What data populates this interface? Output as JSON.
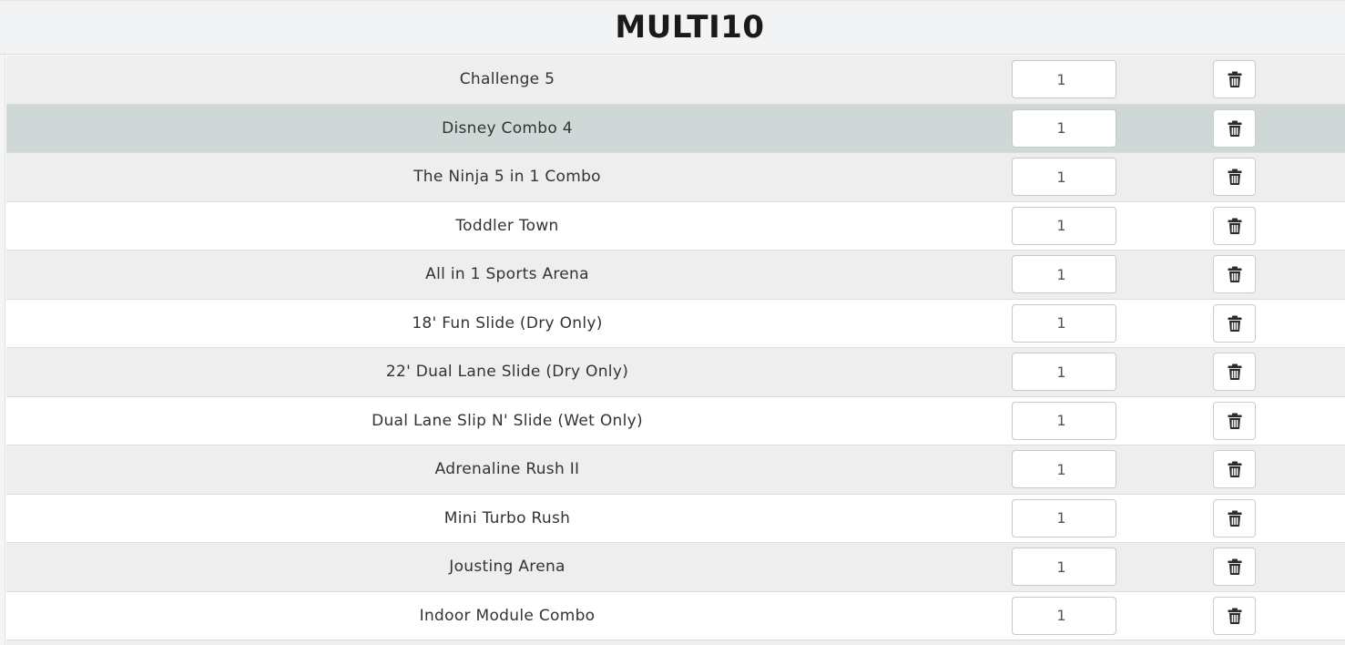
{
  "header": {
    "title": "MULTI10"
  },
  "colors": {
    "header_bg": "#f2f3f5",
    "row_shade": "#eeeeee",
    "row_highlight": "#cfd8d7",
    "row_plain": "#ffffff"
  },
  "items": [
    {
      "name": "Challenge 5",
      "qty": "1",
      "style": "shade",
      "delete_icon": "trash-icon"
    },
    {
      "name": "Disney Combo 4",
      "qty": "1",
      "style": "highlight",
      "delete_icon": "trash-icon"
    },
    {
      "name": "The Ninja 5 in 1 Combo",
      "qty": "1",
      "style": "shade",
      "delete_icon": "trash-icon"
    },
    {
      "name": "Toddler Town",
      "qty": "1",
      "style": "plain",
      "delete_icon": "trash-icon"
    },
    {
      "name": "All in 1 Sports Arena",
      "qty": "1",
      "style": "shade",
      "delete_icon": "trash-icon"
    },
    {
      "name": "18' Fun Slide (Dry Only)",
      "qty": "1",
      "style": "plain",
      "delete_icon": "trash-icon"
    },
    {
      "name": "22' Dual Lane Slide (Dry Only)",
      "qty": "1",
      "style": "shade",
      "delete_icon": "trash-icon"
    },
    {
      "name": "Dual Lane Slip N' Slide (Wet Only)",
      "qty": "1",
      "style": "plain",
      "delete_icon": "trash-icon"
    },
    {
      "name": "Adrenaline Rush II",
      "qty": "1",
      "style": "shade",
      "delete_icon": "trash-icon"
    },
    {
      "name": "Mini Turbo Rush",
      "qty": "1",
      "style": "plain",
      "delete_icon": "trash-icon"
    },
    {
      "name": "Jousting Arena",
      "qty": "1",
      "style": "shade",
      "delete_icon": "trash-icon"
    },
    {
      "name": "Indoor Module Combo",
      "qty": "1",
      "style": "plain",
      "delete_icon": "trash-icon"
    }
  ]
}
